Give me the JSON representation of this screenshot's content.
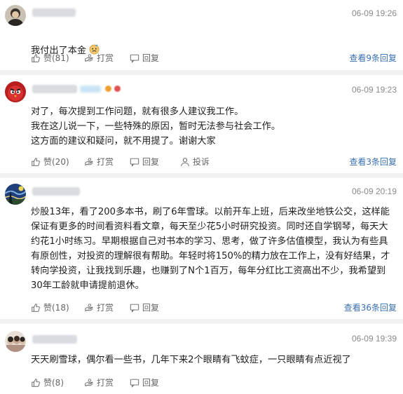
{
  "comments": [
    {
      "time": "06-09 19:26",
      "text": "我付出了本金",
      "emoji": "face-emoji",
      "likes": "赞(81)",
      "tip": "打赏",
      "reply": "回复",
      "replies": "查看9条回复"
    },
    {
      "time": "06-09 19:23",
      "text": "对了，每次提到工作问题，就有很多人建议我工作。\n我在这儿说一下，一些特殊的原因，暂时无法参与社会工作。\n这方面的建议和疑问，就不用提了。谢谢大家",
      "likes": "赞(20)",
      "tip": "打赏",
      "reply": "回复",
      "report": "投诉",
      "replies": "查看3条回复"
    },
    {
      "time": "06-09 20:19",
      "text": "炒股13年，看了200多本书，刷了6年雪球。以前开车上班，后来改坐地铁公交，这样能\n保证有更多的时间看资料看文章，每天至少花5小时研究投资。同时还自学钢琴，每天大\n约花1小时练习。早期根据自己对书本的学习、思考，做了许多估值模型，我认为有些具\n有原创性，对投资的理解很有帮助。年轻时将150%的精力放在工作上，没有好结果，才\n转向学投资，让我找到乐趣，也赚到了N个1百万，每年分红比工资高出不少，我希望到\n30年工龄就申请提前退休。",
      "likes": "赞(18)",
      "tip": "打赏",
      "reply": "回复",
      "replies": "查看36条回复"
    },
    {
      "time": "06-09 19:39",
      "text": "天天刷雪球，偶尔看一些书，几年下来2个眼睛有飞蚊症，一只眼睛有点近视了",
      "likes": "赞(8)",
      "tip": "打赏",
      "reply": "回复"
    }
  ],
  "colors": {
    "link": "#3a6fb0",
    "meta": "#8a8a8a",
    "divider": "#f2f2f2"
  }
}
